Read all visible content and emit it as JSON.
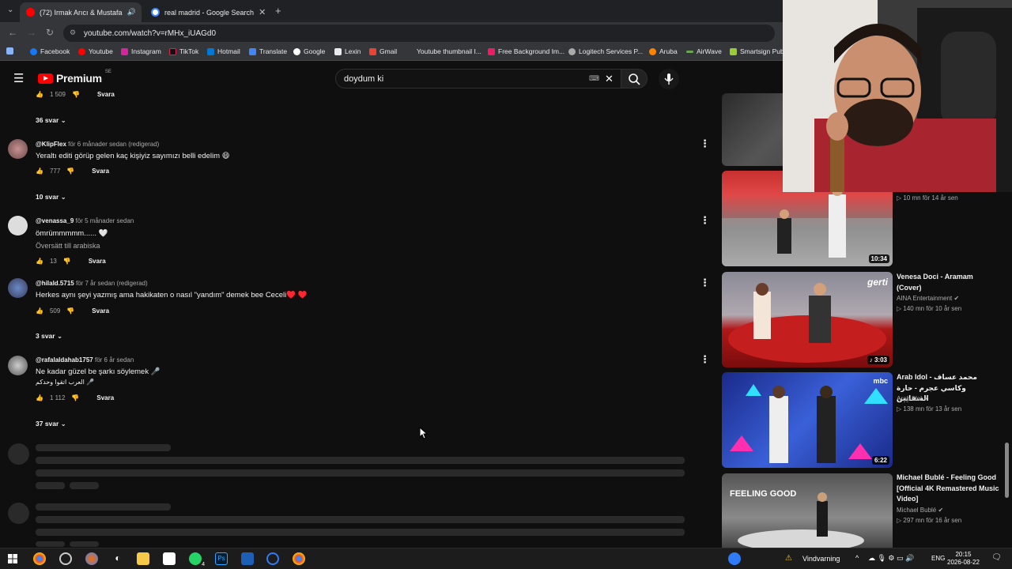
{
  "browser": {
    "tabs": [
      {
        "label": "(72) Irmak Arıcı & Mustafa",
        "active": true
      },
      {
        "label": "real madrid - Google Search",
        "active": false
      }
    ],
    "url": "youtube.com/watch?v=rMHx_iUAGd0",
    "bookmarks": [
      "Facebook",
      "Youtube",
      "Instagram",
      "TikTok",
      "Hotmail",
      "Translate",
      "Google",
      "Lexin",
      "Gmail",
      "Youtube thumbnail I...",
      "Free Background Im...",
      "Logitech Services P...",
      "Aruba",
      "AirWave",
      "Smartsign Publ"
    ]
  },
  "youtube": {
    "logo_text": "Premium",
    "logo_region": "SE",
    "search_value": "doydum ki"
  },
  "comments": {
    "top_partial": {
      "likes": "1 509",
      "reply_label": "Svara",
      "replies_toggle": "36 svar"
    },
    "items": [
      {
        "handle": "@KlipFlex",
        "meta": "för 6 månader sedan (redigerad)",
        "text": "Yeraltı editi görüp gelen kaç kişiyiz sayımızı belli edelim 😄",
        "translate": "",
        "likes": "777",
        "reply_label": "Svara",
        "replies_toggle": "10 svar"
      },
      {
        "handle": "@venassa_9",
        "meta": "för 5 månader sedan",
        "text": "ömrümmmmm...... 🤍",
        "translate": "Översätt till arabiska",
        "likes": "13",
        "reply_label": "Svara",
        "replies_toggle": ""
      },
      {
        "handle": "@hilald.5715",
        "meta": "för 7 år sedan (redigerad)",
        "text": "Herkes aynı şeyi yazmış ama hakikaten o nasıl \"yandım\" demek bee Ceceli♥️ ♥️",
        "translate": "",
        "likes": "509",
        "reply_label": "Svara",
        "replies_toggle": "3 svar"
      },
      {
        "handle": "@rafalaldahab1757",
        "meta": "för 6 år sedan",
        "text": "Ne kadar güzel be şarkı söylemek 🎤",
        "translate": "العرب اتقوا وحدكم 🎤",
        "likes": "1 112",
        "reply_label": "Svara",
        "replies_toggle": "37 svar"
      }
    ]
  },
  "sidebar": {
    "videos": [
      {
        "title": "",
        "channel": "",
        "meta": "10 mn  för 14 år sen",
        "duration": "10:34"
      },
      {
        "title": "Venesa Doci - Aramam (Cover)",
        "channel": "AINA Entertainment",
        "meta": "140 mn  för 10 år sen",
        "duration": "3:03"
      },
      {
        "title": "Arab Idol - محمد عساف وكاسي عجرم - حارة السقايين",
        "channel": "Arab Idol",
        "meta": "138 mn  för 13 år sen",
        "duration": "6:22"
      },
      {
        "title": "Michael Bublé - Feeling Good [Official 4K Remastered Music Video]",
        "channel": "Michael Bublé",
        "meta": "297 mn  för 16 år sen",
        "duration": ""
      }
    ],
    "thumb_text": {
      "gerti": "gerti",
      "feeling_good": "FEELING GOOD",
      "mbc": "mbc"
    }
  },
  "taskbar": {
    "weather": "Vindvarning",
    "lang": "ENG",
    "time": "20:15",
    "date": "2026-08-22",
    "whatsapp_badge": "4"
  }
}
